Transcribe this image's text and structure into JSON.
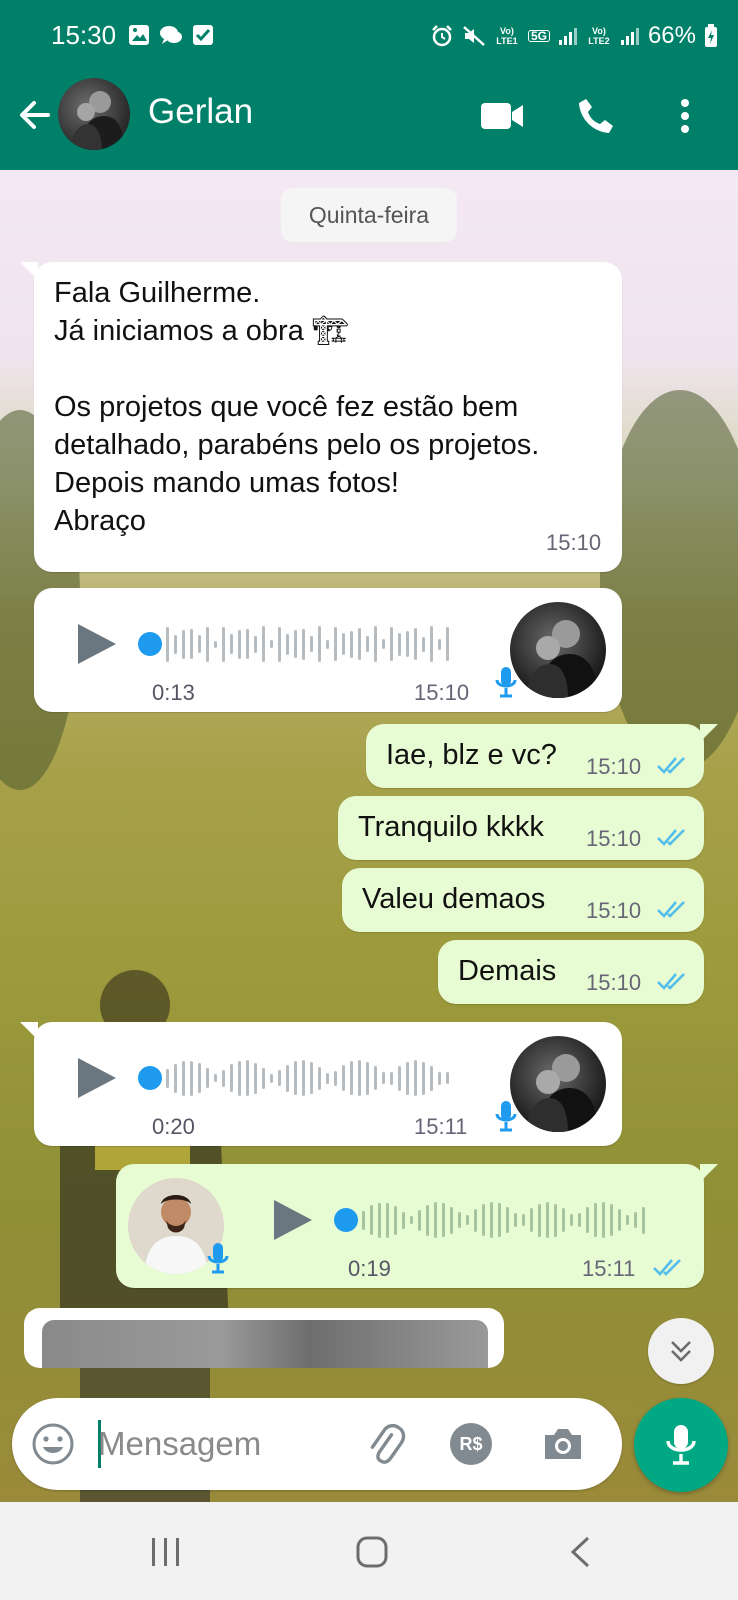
{
  "status_bar": {
    "time": "15:30",
    "battery": "66%",
    "net1": "Vo) LTE1",
    "net2": "Vo) LTE2",
    "net_5g": "5G"
  },
  "header": {
    "contact_name": "Gerlan",
    "icons": [
      "back-arrow-icon",
      "video-call-icon",
      "phone-icon",
      "more-vert-icon"
    ]
  },
  "chat": {
    "date_chip": "Quinta-feira",
    "messages": [
      {
        "dir": "in",
        "type": "text",
        "text": "Fala Guilherme.\nJá iniciamos a obra 🏗\n\nOs projetos que você fez estão bem\ndetalhado, parabéns pelo os projetos.\nDepois mando umas fotos!\nAbraço",
        "time": "15:10"
      },
      {
        "dir": "in",
        "type": "voice",
        "duration": "0:13",
        "time": "15:10"
      },
      {
        "dir": "out",
        "type": "text",
        "text": "Iae, blz e vc?",
        "time": "15:10",
        "status": "read"
      },
      {
        "dir": "out",
        "type": "text",
        "text": "Tranquilo kkkk",
        "time": "15:10",
        "status": "read"
      },
      {
        "dir": "out",
        "type": "text",
        "text": "Valeu demaos",
        "time": "15:10",
        "status": "read"
      },
      {
        "dir": "out",
        "type": "text",
        "text": "Demais",
        "time": "15:10",
        "status": "read"
      },
      {
        "dir": "in",
        "type": "voice",
        "duration": "0:20",
        "time": "15:11"
      },
      {
        "dir": "out",
        "type": "voice",
        "duration": "0:19",
        "time": "15:11",
        "status": "read"
      }
    ]
  },
  "composer": {
    "placeholder": "Mensagem",
    "currency_label": "R$"
  },
  "colors": {
    "header": "#008069",
    "outgoing_bubble": "#e8fcd3",
    "incoming_bubble": "#ffffff",
    "read_ticks": "#53bdeb",
    "fab": "#00a884",
    "voice_dot": "#1e9bef"
  }
}
